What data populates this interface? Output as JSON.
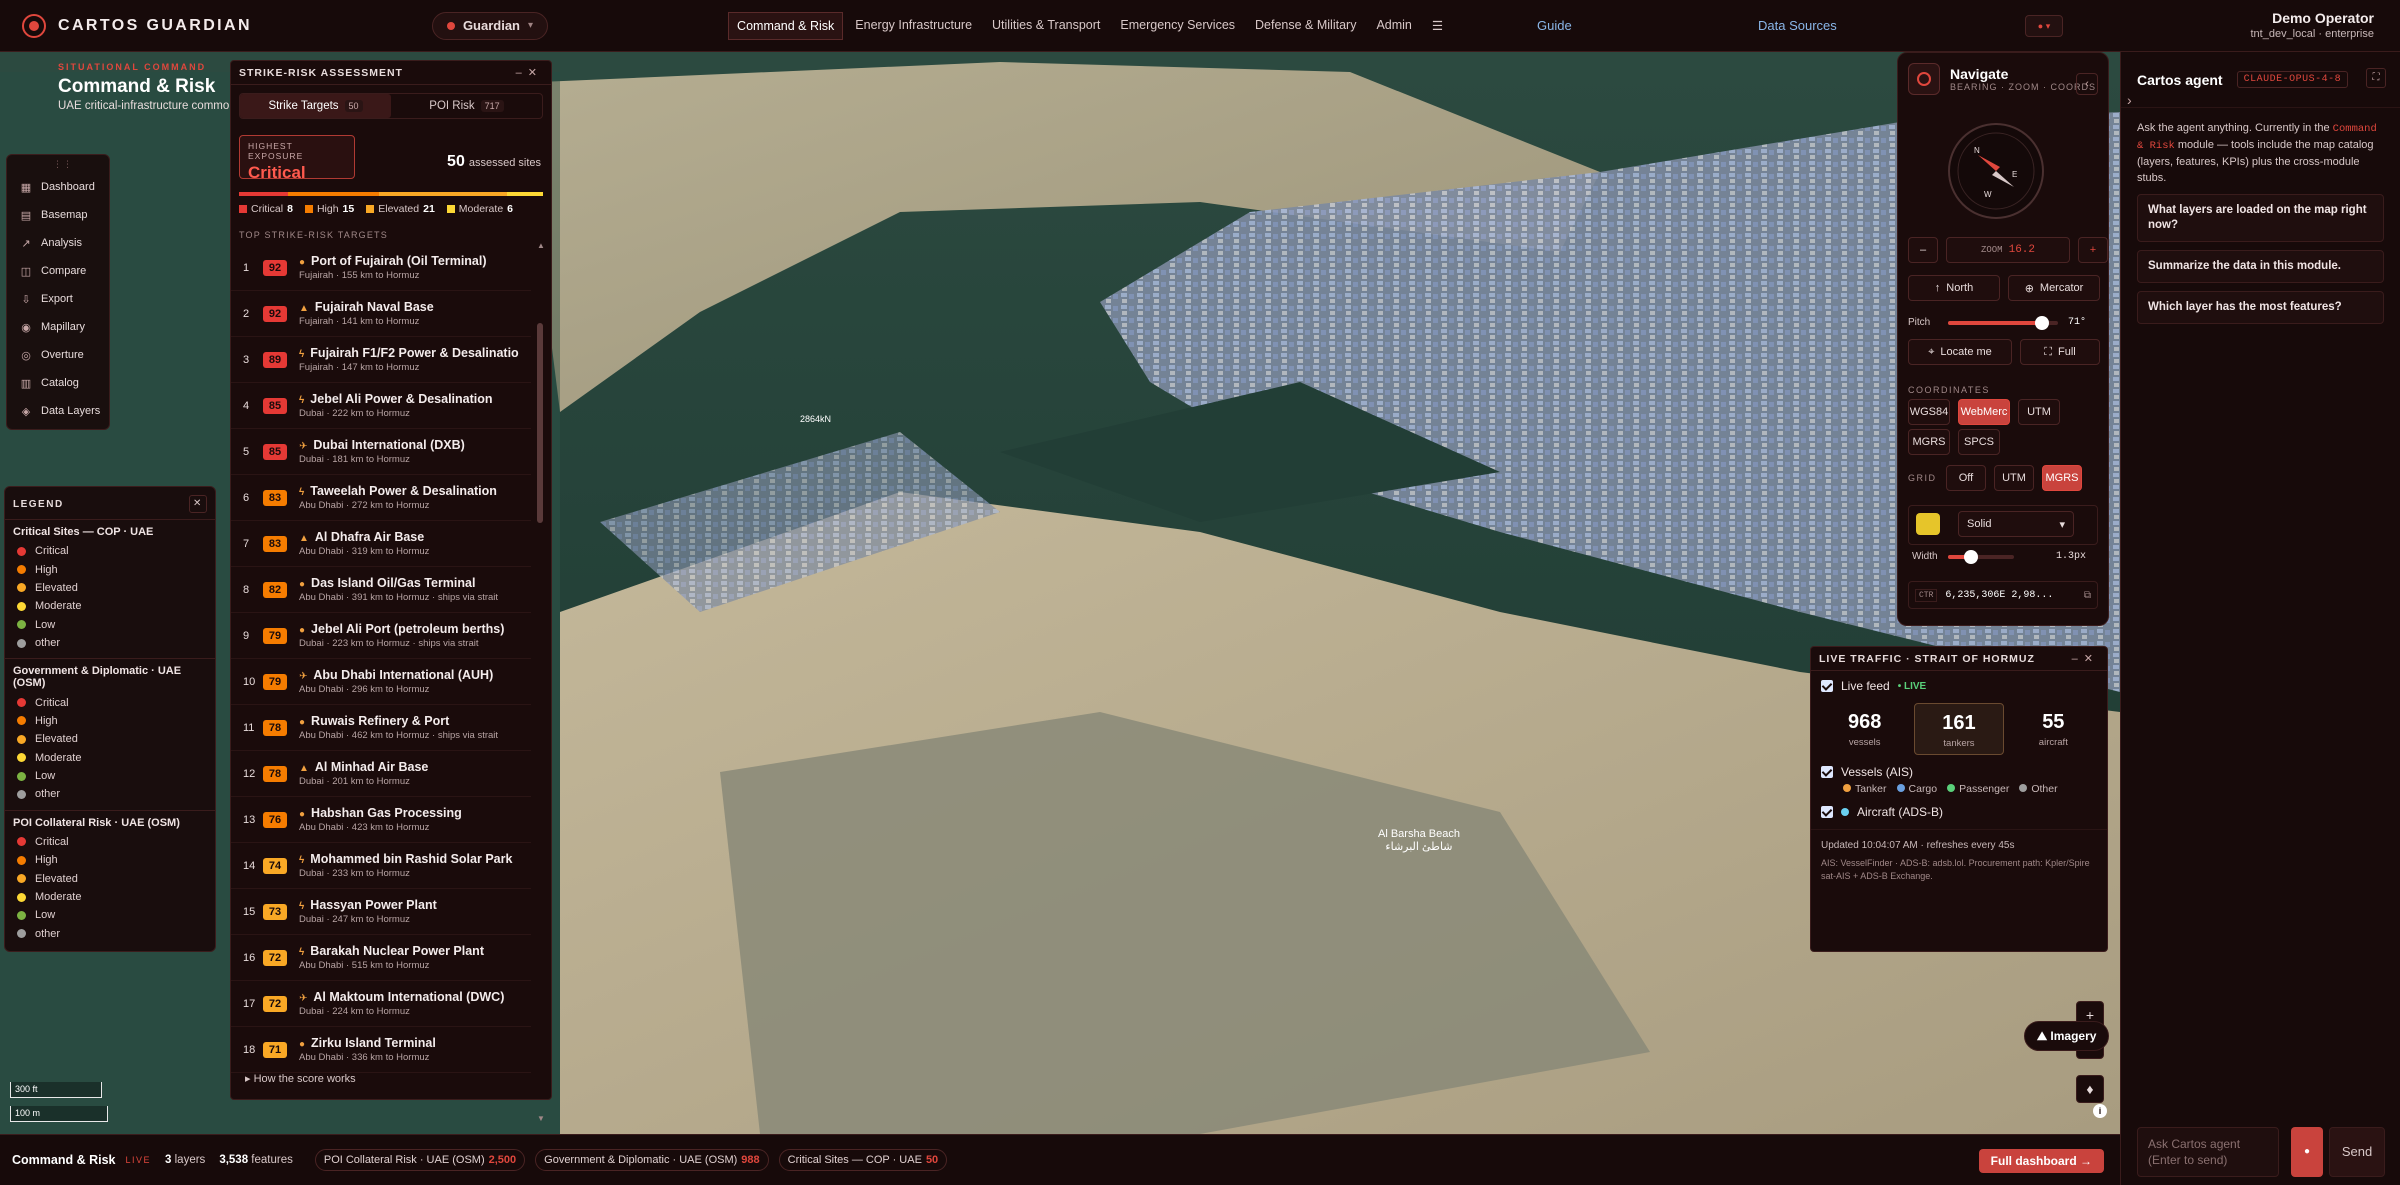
{
  "topbar": {
    "brand": "CARTOS GUARDIAN",
    "persona": "Guardian",
    "nav": [
      "Command & Risk",
      "Energy Infrastructure",
      "Utilities & Transport",
      "Emergency Services",
      "Defense & Military",
      "Admin"
    ],
    "menu_icon": "☰",
    "guide": "Guide",
    "data_sources": "Data Sources",
    "user_name": "Demo Operator",
    "user_tenant": "tnt_dev_local · enterprise"
  },
  "header": {
    "kicker": "SITUATIONAL COMMAND",
    "title": "Command & Risk",
    "subtitle": "UAE critical-infrastructure common o..."
  },
  "tools": [
    "Dashboard",
    "Basemap",
    "Analysis",
    "Compare",
    "Export",
    "Mapillary",
    "Overture",
    "Catalog",
    "Data Layers"
  ],
  "legend": {
    "title": "LEGEND",
    "groups": [
      {
        "title": "Critical Sites — COP · UAE",
        "items": [
          {
            "label": "Critical",
            "color": "#e53935"
          },
          {
            "label": "High",
            "color": "#f57c00"
          },
          {
            "label": "Elevated",
            "color": "#f9a825"
          },
          {
            "label": "Moderate",
            "color": "#fdd835"
          },
          {
            "label": "Low",
            "color": "#7cb342"
          },
          {
            "label": "other",
            "color": "#9e9e9e"
          }
        ]
      },
      {
        "title": "Government & Diplomatic · UAE (OSM)",
        "items": [
          {
            "label": "Critical",
            "color": "#e53935"
          },
          {
            "label": "High",
            "color": "#f57c00"
          },
          {
            "label": "Elevated",
            "color": "#f9a825"
          },
          {
            "label": "Moderate",
            "color": "#fdd835"
          },
          {
            "label": "Low",
            "color": "#7cb342"
          },
          {
            "label": "other",
            "color": "#9e9e9e"
          }
        ]
      },
      {
        "title": "POI Collateral Risk · UAE (OSM)",
        "items": [
          {
            "label": "Critical",
            "color": "#e53935"
          },
          {
            "label": "High",
            "color": "#f57c00"
          },
          {
            "label": "Elevated",
            "color": "#f9a825"
          },
          {
            "label": "Moderate",
            "color": "#fdd835"
          },
          {
            "label": "Low",
            "color": "#7cb342"
          },
          {
            "label": "other",
            "color": "#9e9e9e"
          }
        ]
      }
    ]
  },
  "strike": {
    "title": "STRIKE-RISK ASSESSMENT",
    "tab_targets": "Strike Targets",
    "tab_targets_count": "50",
    "tab_poi": "POI Risk",
    "tab_poi_count": "717",
    "exposure_label": "HIGHEST EXPOSURE",
    "exposure_value": "Critical",
    "assessed_count": "50",
    "assessed_label": "assessed sites",
    "counts": [
      {
        "label": "Critical",
        "value": "8",
        "color": "#e53935"
      },
      {
        "label": "High",
        "value": "15",
        "color": "#f57c00"
      },
      {
        "label": "Elevated",
        "value": "21",
        "color": "#f9a825"
      },
      {
        "label": "Moderate",
        "value": "6",
        "color": "#fdd835"
      }
    ],
    "list_heading": "TOP STRIKE-RISK TARGETS",
    "how": "How the score works",
    "targets": [
      {
        "rank": "1",
        "score": "92",
        "icon": "●",
        "name": "Port of Fujairah (Oil Terminal)",
        "sub": "Fujairah · 155 km to Hormuz"
      },
      {
        "rank": "2",
        "score": "92",
        "icon": "▲",
        "name": "Fujairah Naval Base",
        "sub": "Fujairah · 141 km to Hormuz"
      },
      {
        "rank": "3",
        "score": "89",
        "icon": "ϟ",
        "name": "Fujairah F1/F2 Power & Desalinatio",
        "sub": "Fujairah · 147 km to Hormuz"
      },
      {
        "rank": "4",
        "score": "85",
        "icon": "ϟ",
        "name": "Jebel Ali Power & Desalination",
        "sub": "Dubai · 222 km to Hormuz"
      },
      {
        "rank": "5",
        "score": "85",
        "icon": "✈",
        "name": "Dubai International (DXB)",
        "sub": "Dubai · 181 km to Hormuz"
      },
      {
        "rank": "6",
        "score": "83",
        "icon": "ϟ",
        "name": "Taweelah Power & Desalination",
        "sub": "Abu Dhabi · 272 km to Hormuz"
      },
      {
        "rank": "7",
        "score": "83",
        "icon": "▲",
        "name": "Al Dhafra Air Base",
        "sub": "Abu Dhabi · 319 km to Hormuz"
      },
      {
        "rank": "8",
        "score": "82",
        "icon": "●",
        "name": "Das Island Oil/Gas Terminal",
        "sub": "Abu Dhabi · 391 km to Hormuz · ships via strait"
      },
      {
        "rank": "9",
        "score": "79",
        "icon": "●",
        "name": "Jebel Ali Port (petroleum berths)",
        "sub": "Dubai · 223 km to Hormuz · ships via strait"
      },
      {
        "rank": "10",
        "score": "79",
        "icon": "✈",
        "name": "Abu Dhabi International (AUH)",
        "sub": "Abu Dhabi · 296 km to Hormuz"
      },
      {
        "rank": "11",
        "score": "78",
        "icon": "●",
        "name": "Ruwais Refinery & Port",
        "sub": "Abu Dhabi · 462 km to Hormuz · ships via strait"
      },
      {
        "rank": "12",
        "score": "78",
        "icon": "▲",
        "name": "Al Minhad Air Base",
        "sub": "Dubai · 201 km to Hormuz"
      },
      {
        "rank": "13",
        "score": "76",
        "icon": "●",
        "name": "Habshan Gas Processing",
        "sub": "Abu Dhabi · 423 km to Hormuz"
      },
      {
        "rank": "14",
        "score": "74",
        "icon": "ϟ",
        "name": "Mohammed bin Rashid Solar Park",
        "sub": "Dubai · 233 km to Hormuz"
      },
      {
        "rank": "15",
        "score": "73",
        "icon": "ϟ",
        "name": "Hassyan Power Plant",
        "sub": "Dubai · 247 km to Hormuz"
      },
      {
        "rank": "16",
        "score": "72",
        "icon": "ϟ",
        "name": "Barakah Nuclear Power Plant",
        "sub": "Abu Dhabi · 515 km to Hormuz"
      },
      {
        "rank": "17",
        "score": "72",
        "icon": "✈",
        "name": "Al Maktoum International (DWC)",
        "sub": "Dubai · 224 km to Hormuz"
      },
      {
        "rank": "18",
        "score": "71",
        "icon": "●",
        "name": "Zirku Island Terminal",
        "sub": "Abu Dhabi · 336 km to Hormuz"
      }
    ]
  },
  "scale": {
    "ft": "300 ft",
    "m": "100 m"
  },
  "map_labels": {
    "n1": "2864kN",
    "n2": "Al Barsha Beach",
    "n3": "شاطئ البرشاء"
  },
  "navigate": {
    "title": "Navigate",
    "subtitle": "BEARING · ZOOM · COORDS",
    "zoom_label": "ZOOM",
    "zoom_value": "16.2",
    "north": "North",
    "projection": "Mercator",
    "pitch_label": "Pitch",
    "pitch_value": "71°",
    "pitch_fraction": 0.85,
    "locate": "Locate me",
    "full": "Full",
    "coords_label": "COORDINATES",
    "coord_opts": [
      "WGS84",
      "WebMerc",
      "UTM",
      "MGRS",
      "SPCS"
    ],
    "coord_selected": "WebMerc",
    "grid_label": "GRID",
    "grid_opts": [
      "Off",
      "UTM",
      "MGRS"
    ],
    "grid_selected": "MGRS",
    "line_style": "Solid",
    "line_color": "#e6c52a",
    "width_label": "Width",
    "width_value": "1.3px",
    "width_fraction": 0.35,
    "ctr_label": "CTR",
    "ctr_value": "6,235,306E 2,98..."
  },
  "agent": {
    "title": "Cartos agent",
    "model": "CLAUDE-OPUS-4-8",
    "intro_a": "Ask the agent anything. Currently in the ",
    "intro_code": "Command & Risk",
    "intro_b": " module — tools include the map catalog (layers, features, KPIs) plus the cross-module stubs.",
    "suggestions": [
      "What layers are loaded on the map right now?",
      "Summarize the data in this module.",
      "Which layer has the most features?"
    ],
    "placeholder": "Ask Cartos agent (Enter to send)",
    "send": "Send"
  },
  "traffic": {
    "title": "LIVE TRAFFIC · STRAIT OF HORMUZ",
    "live_feed": "Live feed",
    "live": "• LIVE",
    "stats": [
      {
        "value": "968",
        "label": "vessels"
      },
      {
        "value": "161",
        "label": "tankers"
      },
      {
        "value": "55",
        "label": "aircraft"
      }
    ],
    "vessels": "Vessels (AIS)",
    "vessel_types": [
      {
        "label": "Tanker",
        "color": "#f0a040"
      },
      {
        "label": "Cargo",
        "color": "#6aa0e0"
      },
      {
        "label": "Passenger",
        "color": "#5ad07a"
      },
      {
        "label": "Other",
        "color": "#9e9e9e"
      }
    ],
    "aircraft": "Aircraft (ADS-B)",
    "updated": "Updated 10:04:07 AM · refreshes every 45s",
    "sources": "AIS: VesselFinder · ADS-B: adsb.lol. Procurement path: Kpler/Spire sat-AIS + ADS-B Exchange."
  },
  "imagery": "Imagery",
  "bottom": {
    "title": "Command & Risk",
    "live": "LIVE",
    "layers": "3",
    "layers_label": "layers",
    "features": "3,538",
    "features_label": "features",
    "chips": [
      {
        "label": "POI Collateral Risk · UAE (OSM)",
        "count": "2,500"
      },
      {
        "label": "Government & Diplomatic · UAE (OSM)",
        "count": "988"
      },
      {
        "label": "Critical Sites — COP · UAE",
        "count": "50"
      }
    ],
    "full_dashboard": "Full dashboard →"
  }
}
